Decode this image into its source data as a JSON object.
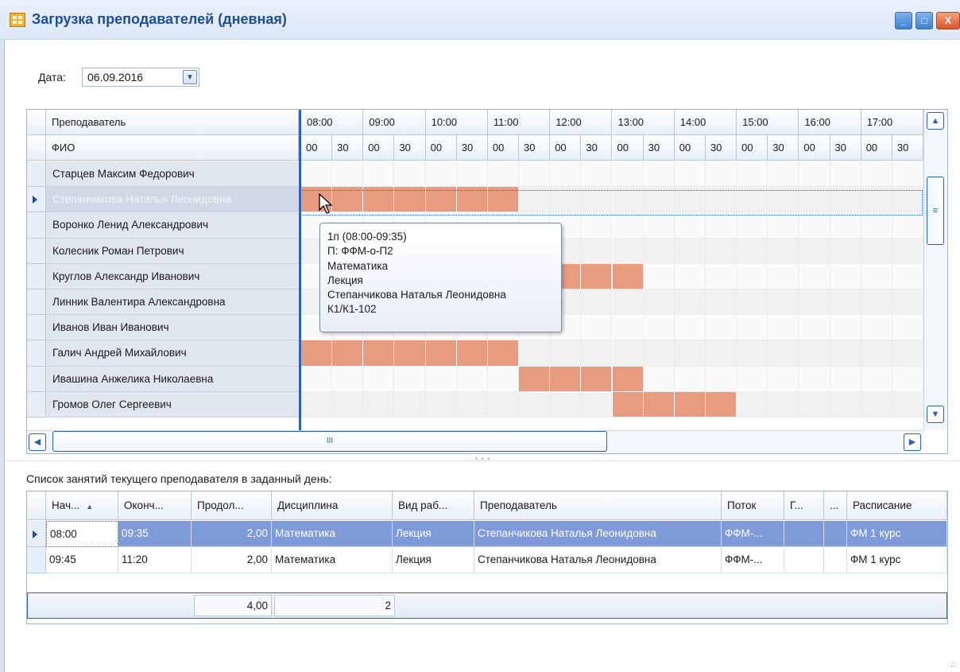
{
  "window": {
    "title": "Загрузка преподавателей (дневная)",
    "min": "_",
    "max": "□",
    "close": "X"
  },
  "date": {
    "label": "Дата:",
    "value": "06.09.2016"
  },
  "grid": {
    "header_teacher": "Преподаватель",
    "header_fio": "ФИО",
    "hours": [
      "08:00",
      "09:00",
      "10:00",
      "11:00",
      "12:00",
      "13:00",
      "14:00",
      "15:00",
      "16:00",
      "17:00"
    ],
    "minutes": [
      "00",
      "30",
      "00",
      "30",
      "00",
      "30",
      "00",
      "30",
      "00",
      "30",
      "00",
      "30",
      "00",
      "30",
      "00",
      "30",
      "00",
      "30",
      "00",
      "30"
    ],
    "teachers": [
      "Старцев Максим Федорович",
      "Степанчикова Наталья Леонидовна",
      "Воронко Ленид Александрович",
      "Колесник Роман Петрович",
      "Круглов Александр Иванович",
      "Линник Валентира Александровна",
      "Иванов Иван Иванович",
      "Галич Андрей Михайлович",
      "Ивашина Анжелика Николаевна",
      "Громов Олег Сергеевич"
    ],
    "selected_row": 1,
    "busy": [
      [],
      [
        0,
        1,
        2,
        3,
        4,
        5,
        6
      ],
      [],
      [],
      [
        8,
        9,
        10
      ],
      [],
      [],
      [
        0,
        1,
        2,
        3,
        4,
        5,
        6
      ],
      [
        7,
        8,
        9,
        10
      ],
      [
        10,
        11,
        12,
        13
      ]
    ],
    "busy_color": "#e99b7f",
    "hscroll_thumb": "III"
  },
  "tooltip": {
    "lines": [
      "1п (08:00-09:35)",
      "П: ФФМ-о-П2",
      "Математика",
      "Лекция",
      "Степанчикова Наталья Леонидовна",
      "К1/К1-102"
    ]
  },
  "list_label": "Список занятий текущего преподавателя в заданный день:",
  "lessons": {
    "columns": [
      "Нач...",
      "Оконч...",
      "Продол...",
      "Дисциплина",
      "Вид раб...",
      "Преподаватель",
      "Поток",
      "Г...",
      "...",
      "Расписание"
    ],
    "rows": [
      [
        "08:00",
        "09:35",
        "2,00",
        "Математика",
        "Лекция",
        "Степанчикова Наталья Леонидовна",
        "ФФМ-...",
        "",
        "",
        "ФМ 1 курс"
      ],
      [
        "09:45",
        "11:20",
        "2,00",
        "Математика",
        "Лекция",
        "Степанчикова Наталья Леонидовна",
        "ФФМ-...",
        "",
        "",
        "ФМ 1 курс"
      ]
    ],
    "footer": {
      "duration_total": "4,00",
      "count": "2"
    },
    "selected_row_color": "#7f9ad8"
  }
}
